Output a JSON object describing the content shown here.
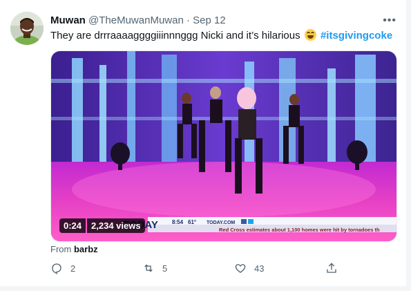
{
  "tweet": {
    "display_name": "Muwan",
    "handle": "@TheMuwanMuwan",
    "separator": "·",
    "date": "Sep 12",
    "text": "They are drrraaaaggggiiinnnggg Nicki and it’s hilarious",
    "emoji": "face-with-tears-of-joy-icon",
    "hashtag": "#itsgivingcoke",
    "more_icon": "•••"
  },
  "video": {
    "timestamp": "0:24",
    "views": "2,234 views",
    "broadcast": {
      "logo": "TODAY",
      "time": "8:54",
      "temp": "61°",
      "site": "TODAY.COM",
      "ticker": "Red Cross estimates about 1,100 homes were hit by tornadoes th"
    }
  },
  "source": {
    "prefix": "From",
    "name": "barbz"
  },
  "actions": {
    "replies": "2",
    "retweets": "5",
    "likes": "43"
  },
  "colors": {
    "link": "#1d9bf0",
    "secondary_text": "#536471",
    "stage_pink": "#e22fc0",
    "stage_purple": "#5b2bb0"
  }
}
